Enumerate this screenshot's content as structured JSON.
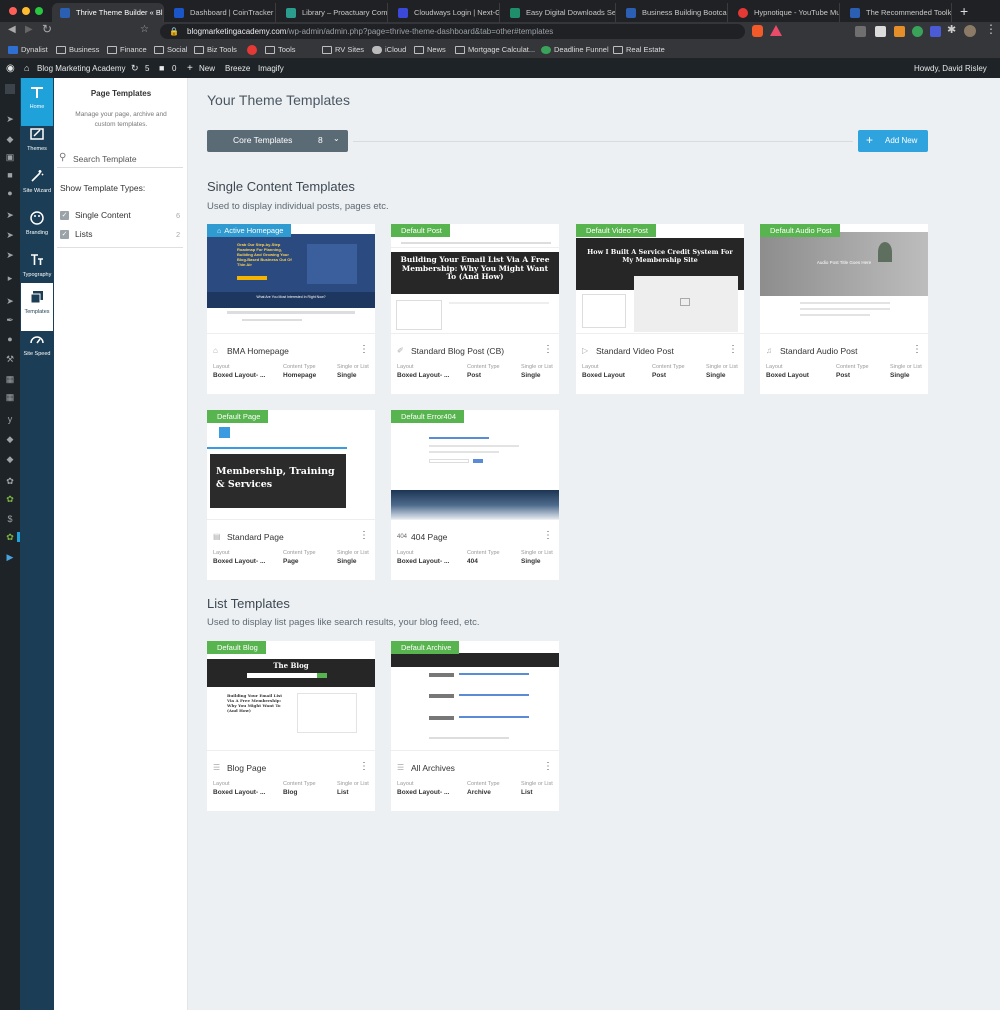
{
  "browser": {
    "tabs": [
      {
        "title": "Thrive Theme Builder « Bl",
        "active": true,
        "color": "#2a5fb3"
      },
      {
        "title": "Dashboard | CoinTracker",
        "color": "#1a56c7"
      },
      {
        "title": "Library – Proactuary Commun",
        "color": "#2a9d8f"
      },
      {
        "title": "Cloudways Login | Next-Gen",
        "color": "#3a49d9"
      },
      {
        "title": "Easy Digital Downloads Setti",
        "color": "#1f8f6b"
      },
      {
        "title": "Business Building Bootcamp",
        "color": "#2a5fb3"
      },
      {
        "title": "Hypnotique - YouTube Mu",
        "color": "#e53935"
      },
      {
        "title": "The Recommended Toolkit -",
        "color": "#2a5fb3"
      }
    ],
    "url_domain": "blogmarketingacademy.com",
    "url_path": "/wp-admin/admin.php?page=thrive-theme-dashboard&tab=other#templates",
    "bookmarks": [
      "Dynalist",
      "Business",
      "Finance",
      "Social",
      "Biz Tools",
      "Tools",
      "RV Sites",
      "iCloud",
      "News",
      "Mortgage Calculat...",
      "Deadline Funnel",
      "Real Estate"
    ]
  },
  "wpbar": {
    "site": "Blog Marketing Academy",
    "updates": "5",
    "comments": "0",
    "new": "New",
    "breeze": "Breeze",
    "imagify": "Imagify",
    "howdy": "Howdy, David Risley"
  },
  "thrive_nav": [
    {
      "label": "Home",
      "icon": "home-icon"
    },
    {
      "label": "Themes",
      "icon": "themes-icon"
    },
    {
      "label": "Site Wizard",
      "icon": "wand-icon"
    },
    {
      "label": "Branding",
      "icon": "palette-icon"
    },
    {
      "label": "Typography",
      "icon": "typography-icon"
    },
    {
      "label": "Templates",
      "icon": "templates-icon"
    },
    {
      "label": "Site Speed",
      "icon": "speedometer-icon"
    }
  ],
  "panel": {
    "title": "Page Templates",
    "description": "Manage your page, archive and custom templates.",
    "search_placeholder": "Search Template",
    "show_types_label": "Show Template Types:",
    "types": [
      {
        "label": "Single Content",
        "count": "6"
      },
      {
        "label": "Lists",
        "count": "2"
      }
    ]
  },
  "main": {
    "heading": "Your Theme Templates",
    "core_templates_label": "Core Templates",
    "core_templates_count": "8",
    "add_new_label": "Add New",
    "single_title": "Single Content Templates",
    "single_subtitle": "Used to display individual posts, pages etc.",
    "list_title": "List Templates",
    "list_subtitle": "Used to display list pages like search results, your blog feed, etc.",
    "meta_headers": {
      "layout": "Layout",
      "content_type": "Content Type",
      "single_or_list": "Single or List"
    }
  },
  "cards": [
    {
      "badge": "Active Homepage",
      "name": "BMA Homepage",
      "layout": "Boxed Layout- ...",
      "content_type": "Homepage",
      "single_or_list": "Single",
      "thumb_title": "Grab Our Step-by-Step Roadmap For Planning, Building And Growing Your Blog-Based Business Out Of Thin Air",
      "thumb_sub": "What Are You Most Interested In Right Now?"
    },
    {
      "badge": "Default Post",
      "name": "Standard Blog Post (CB)",
      "layout": "Boxed Layout- ...",
      "content_type": "Post",
      "single_or_list": "Single",
      "thumb_title": "Building Your Email List Via A Free Membership: Why You Might Want To (And How)"
    },
    {
      "badge": "Default Video Post",
      "name": "Standard Video Post",
      "layout": "Boxed Layout",
      "content_type": "Post",
      "single_or_list": "Single",
      "thumb_title": "How I Built A Service Credit System For My Membership Site"
    },
    {
      "badge": "Default Audio Post",
      "name": "Standard Audio Post",
      "layout": "Boxed Layout",
      "content_type": "Post",
      "single_or_list": "Single",
      "thumb_title": "Audio Post Title Goes Here"
    },
    {
      "badge": "Default Page",
      "name": "Standard Page",
      "layout": "Boxed Layout- ...",
      "content_type": "Page",
      "single_or_list": "Single",
      "thumb_title": "Membership, Training & Services"
    },
    {
      "badge": "Default Error404",
      "name": "404 Page",
      "name_prefix": "404",
      "layout": "Boxed Layout- ...",
      "content_type": "404",
      "single_or_list": "Single"
    },
    {
      "badge": "Default Blog",
      "name": "Blog Page",
      "layout": "Boxed Layout- ...",
      "content_type": "Blog",
      "single_or_list": "List",
      "thumb_title": "The Blog",
      "thumb_post": "Building Your Email List Via A Free Membership: Why You Might Want To (And How)"
    },
    {
      "badge": "Default Archive",
      "name": "All Archives",
      "layout": "Boxed Layout- ...",
      "content_type": "Archive",
      "single_or_list": "List"
    }
  ],
  "colors": {
    "thrive_nav": "#1b3d55",
    "thrive_accent": "#1fa2d9",
    "badge_green": "#58b44e",
    "core_button": "#5b6b76"
  }
}
